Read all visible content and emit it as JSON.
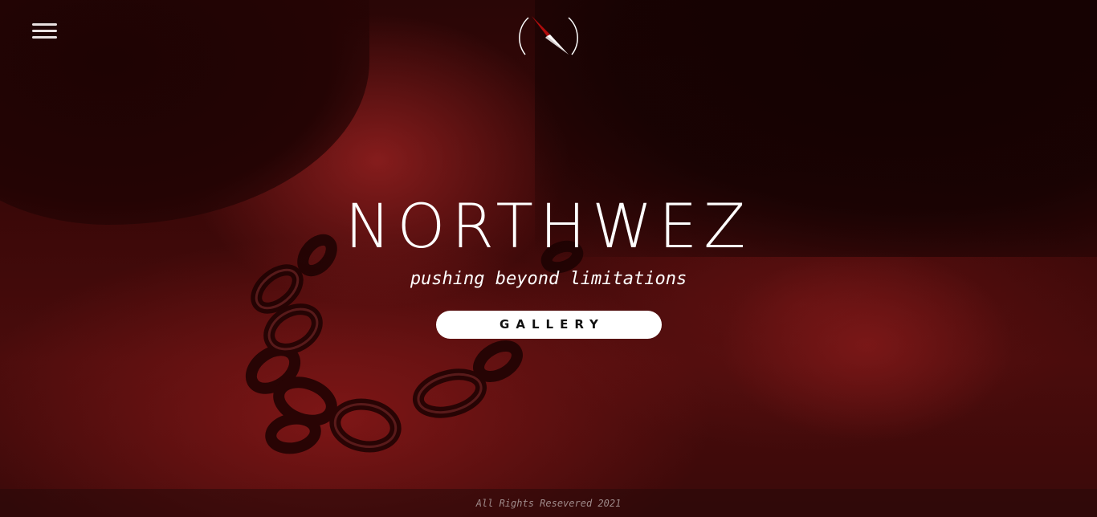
{
  "header": {
    "menu_icon": "hamburger-menu-icon",
    "logo_icon": "compass-needle-icon"
  },
  "hero": {
    "title": "NORTHWEZ",
    "subtitle": "pushing beyond limitations",
    "cta_label": "GALLERY"
  },
  "footer": {
    "copyright": "All Rights Resevered 2021"
  },
  "colors": {
    "background": "#3a0808",
    "accent_red": "#e01010",
    "text": "#ffffff",
    "button_bg": "#ffffff",
    "button_text": "#111111"
  }
}
